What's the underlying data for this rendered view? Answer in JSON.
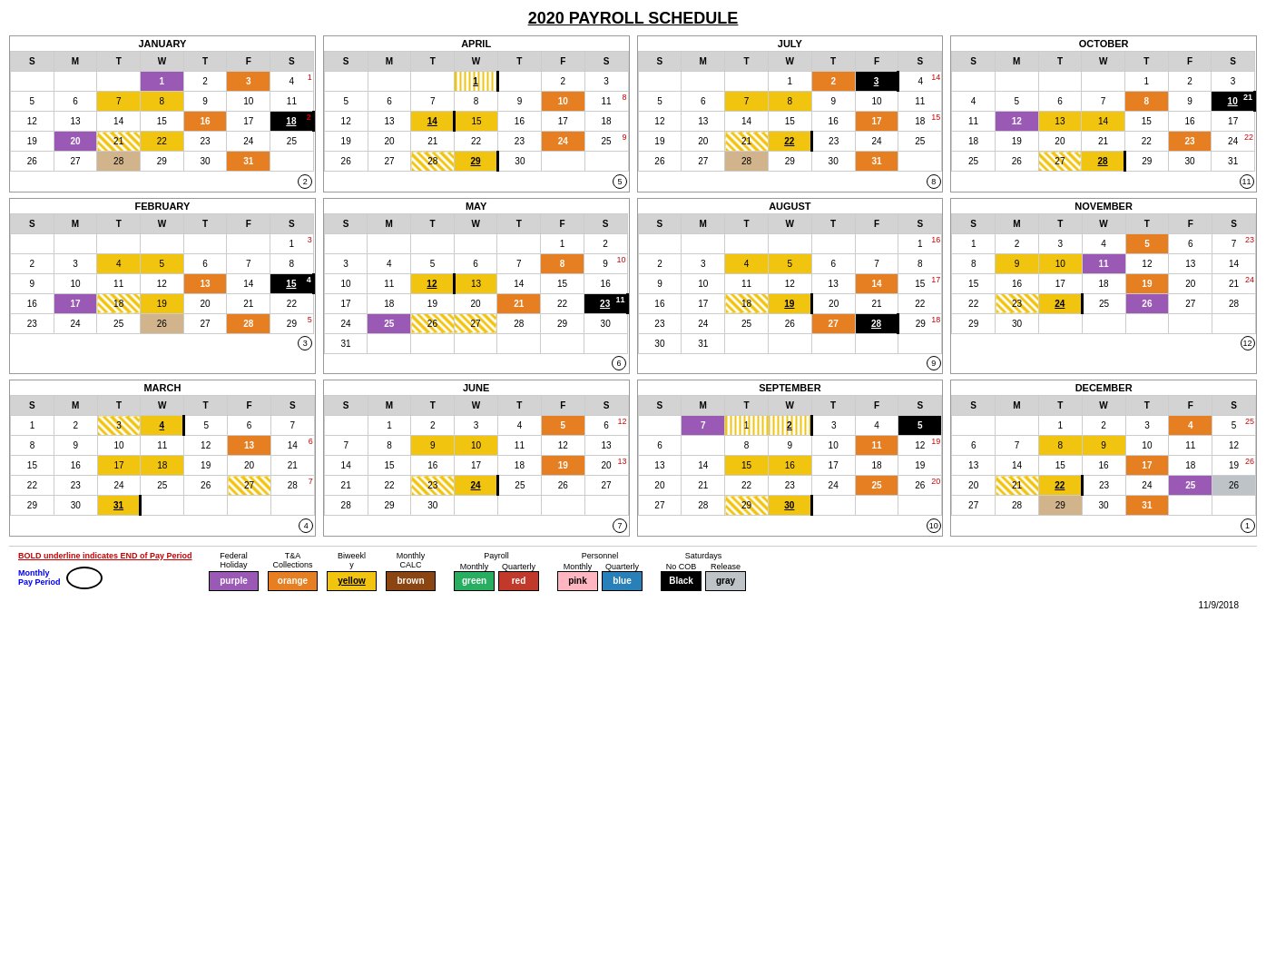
{
  "title": "2020 PAYROLL SCHEDULE",
  "months": [
    {
      "name": "JANUARY",
      "weekNum": "2"
    },
    {
      "name": "FEBRUARY",
      "weekNum": "3"
    },
    {
      "name": "MARCH",
      "weekNum": "4"
    },
    {
      "name": "APRIL",
      "weekNum": "5"
    },
    {
      "name": "MAY",
      "weekNum": "6"
    },
    {
      "name": "JUNE",
      "weekNum": "7"
    },
    {
      "name": "JULY",
      "weekNum": "8"
    },
    {
      "name": "AUGUST",
      "weekNum": "9"
    },
    {
      "name": "SEPTEMBER",
      "weekNum": "10"
    },
    {
      "name": "OCTOBER",
      "weekNum": "11"
    },
    {
      "name": "NOVEMBER",
      "weekNum": "12"
    },
    {
      "name": "DECEMBER",
      "weekNum": "1"
    }
  ],
  "legend": {
    "bold_underline_text": "BOLD underline indicates END of Pay Period",
    "federal_holiday": "Federal Holiday",
    "federal_holiday_color": "purple",
    "ta_collections": "T&A Collections",
    "ta_color": "orange",
    "biweekly": "Biweekly",
    "biweekly_color": "yellow",
    "monthly_calc": "Monthly CALC",
    "monthly_calc_color": "brown",
    "payroll_monthly": "Payroll Monthly",
    "payroll_monthly_color": "green",
    "payroll_quarterly": "Quarterly",
    "payroll_quarterly_color": "red",
    "personnel_monthly": "Personnel Monthly",
    "personnel_monthly_color": "pink",
    "personnel_quarterly": "Personnel Quarterly",
    "personnel_quarterly_color": "blue",
    "saturdays_no_cob": "Saturdays No COB",
    "saturdays_no_cob_color": "Black",
    "release": "Release",
    "release_color": "gray",
    "monthly_pp_label": "Monthly\nPay Period"
  },
  "date_stamp": "11/9/2018"
}
